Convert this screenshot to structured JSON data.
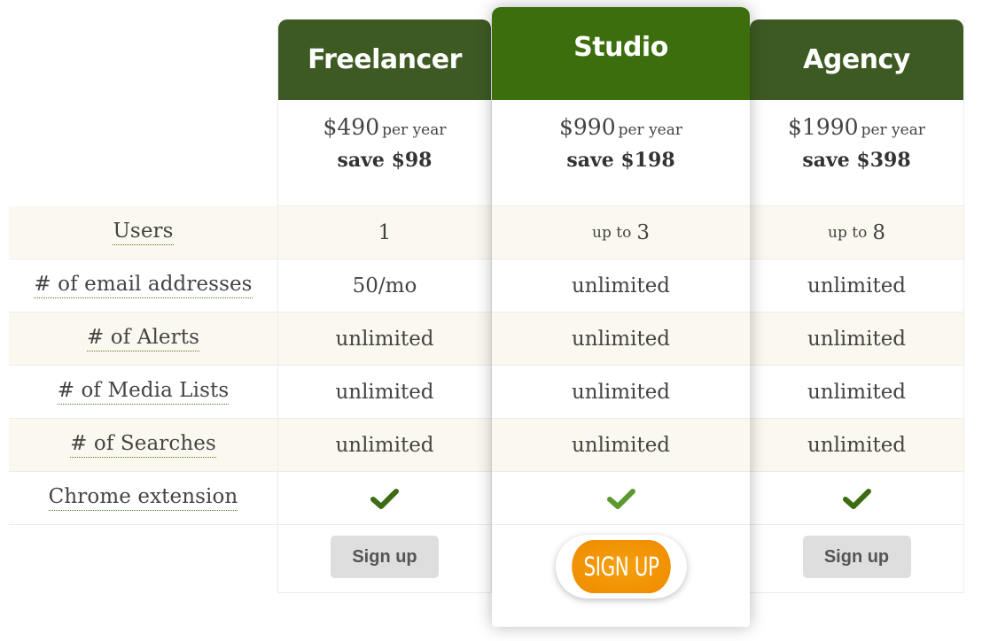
{
  "features": [
    {
      "label": "Users"
    },
    {
      "label": "# of email addresses"
    },
    {
      "label": "# of Alerts"
    },
    {
      "label": "# of Media Lists"
    },
    {
      "label": "# of Searches"
    },
    {
      "label": "Chrome extension"
    }
  ],
  "plans": [
    {
      "name": "Freelancer",
      "price": "$490",
      "period": "per year",
      "save": "save $98",
      "values": [
        {
          "pre": "",
          "value": "1"
        },
        {
          "pre": "",
          "value": "50/mo"
        },
        {
          "pre": "",
          "value": "unlimited"
        },
        {
          "pre": "",
          "value": "unlimited"
        },
        {
          "pre": "",
          "value": "unlimited"
        },
        {
          "check": "checkmark-icon"
        }
      ],
      "button_label": "Sign up",
      "check_color": "#3d6b12"
    },
    {
      "name": "Studio",
      "price": "$990",
      "period": "per year",
      "save": "save $198",
      "values": [
        {
          "pre": "up to",
          "value": "3"
        },
        {
          "pre": "",
          "value": "unlimited"
        },
        {
          "pre": "",
          "value": "unlimited"
        },
        {
          "pre": "",
          "value": "unlimited"
        },
        {
          "pre": "",
          "value": "unlimited"
        },
        {
          "check": "checkmark-icon"
        }
      ],
      "button_label": "SIGN UP",
      "check_color": "#5b9a30",
      "featured": true
    },
    {
      "name": "Agency",
      "price": "$1990",
      "period": "per year",
      "save": "save $398",
      "values": [
        {
          "pre": "up to",
          "value": "8"
        },
        {
          "pre": "",
          "value": "unlimited"
        },
        {
          "pre": "",
          "value": "unlimited"
        },
        {
          "pre": "",
          "value": "unlimited"
        },
        {
          "pre": "",
          "value": "unlimited"
        },
        {
          "check": "checkmark-icon"
        }
      ],
      "button_label": "Sign up",
      "check_color": "#3d6b12"
    }
  ],
  "colors": {
    "header_side": "#3e5a23",
    "header_featured": "#3c6e0e",
    "accent_orange": "#ef8f00",
    "row_alt": "#fbf9ef"
  }
}
